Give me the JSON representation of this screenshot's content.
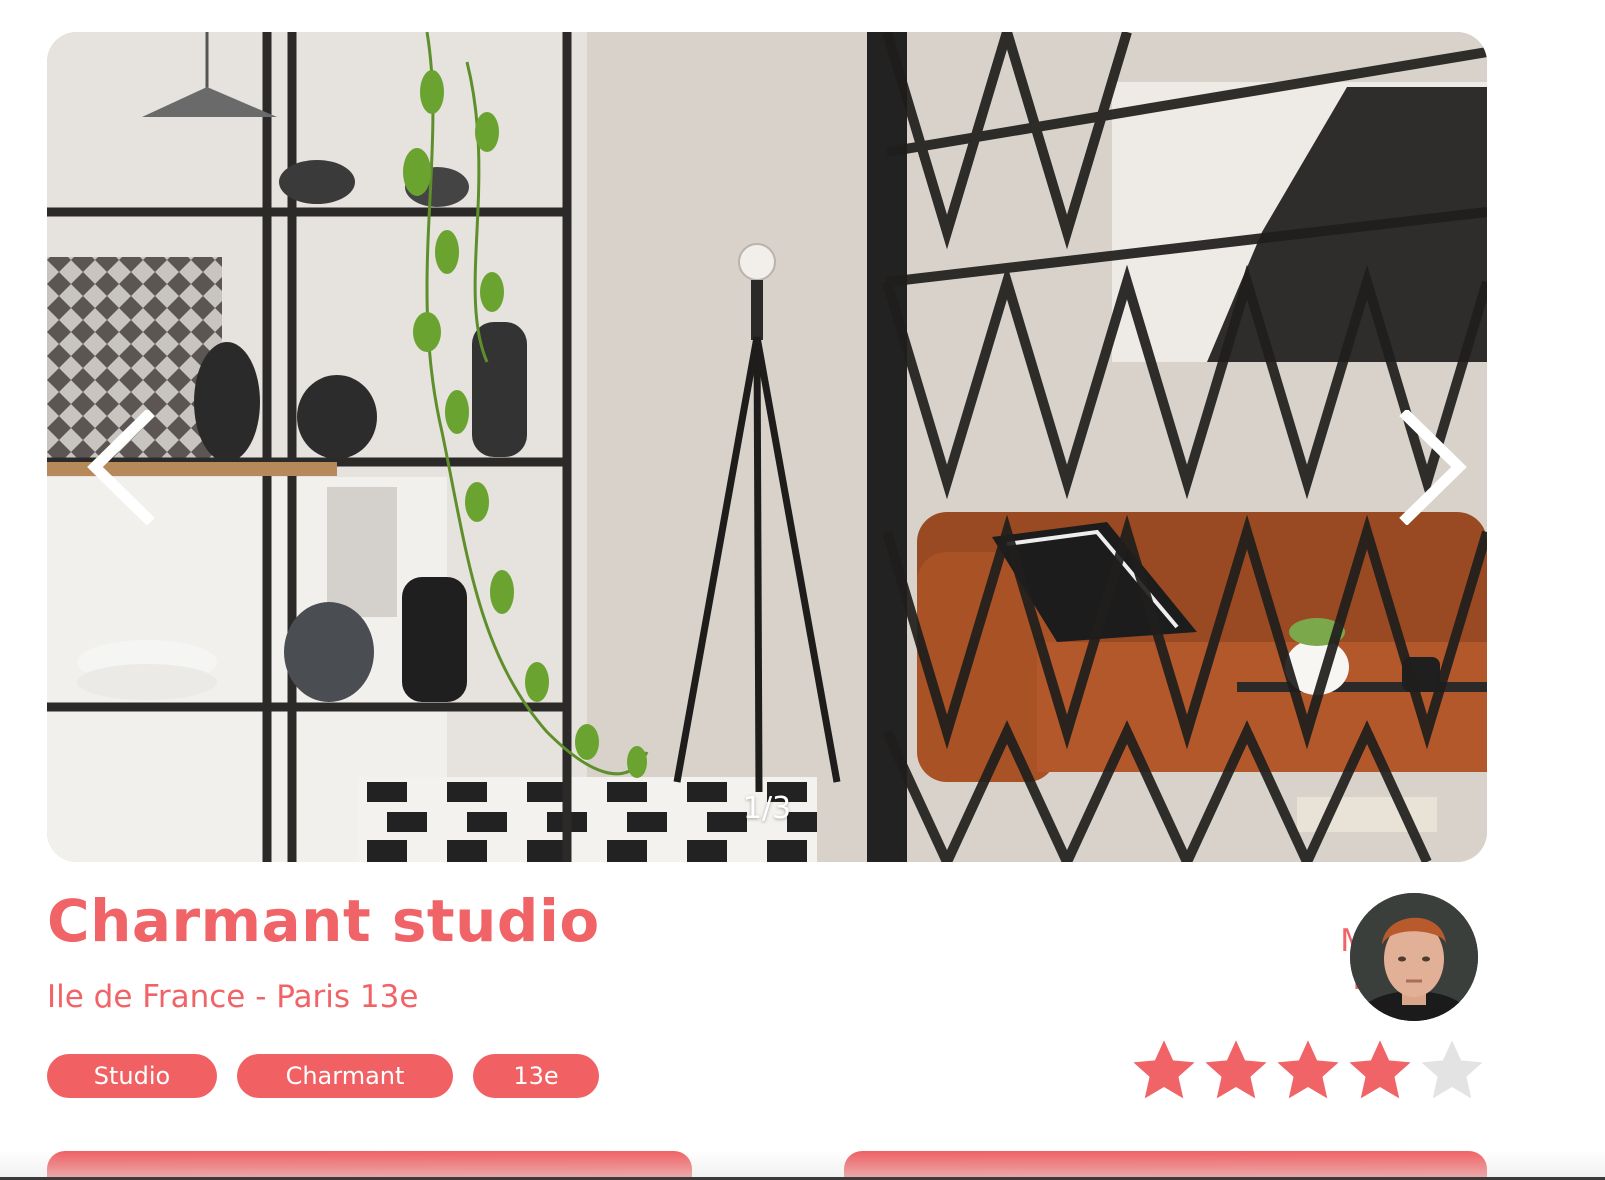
{
  "carousel": {
    "counter": "1/3",
    "prev_icon": "chevron-left-icon",
    "next_icon": "chevron-right-icon",
    "image": "living room with shelves, plant, tripod lamp and orange sofa"
  },
  "listing": {
    "title": "Charmant studio",
    "location": "Ile de France - Paris 13e",
    "tags": [
      "Studio",
      "Charmant",
      "13e"
    ]
  },
  "host": {
    "first_name": "Michel",
    "last_name": "Romy"
  },
  "rating": {
    "value": 4,
    "max": 5
  },
  "colors": {
    "accent": "#f06467",
    "star_empty": "#e3e3e3",
    "text_on_accent": "#ffffff"
  }
}
